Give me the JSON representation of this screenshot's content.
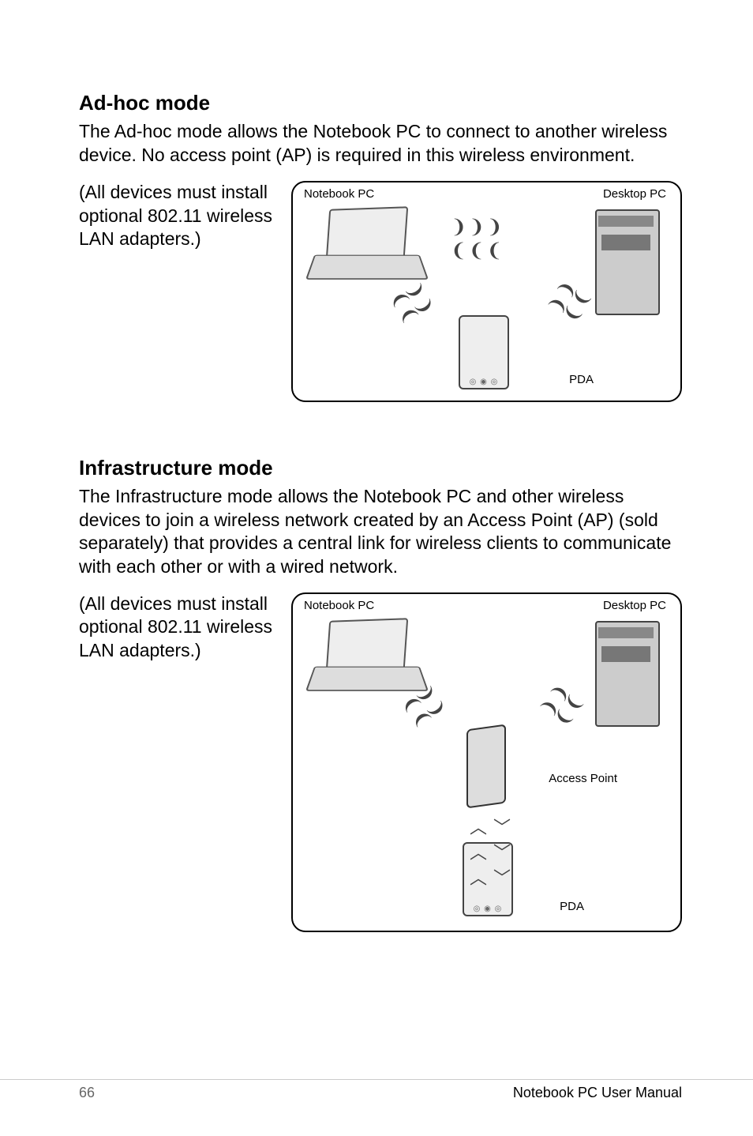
{
  "sections": {
    "adhoc": {
      "title": "Ad-hoc mode",
      "text": "The Ad-hoc mode allows the Notebook PC to connect to another wireless device. No access point (AP) is required in this wireless environment.",
      "note": "(All devices must install optional 802.11 wireless LAN adapters.)",
      "labels": {
        "notebook": "Notebook PC",
        "desktop": "Desktop PC",
        "pda": "PDA"
      }
    },
    "infra": {
      "title": "Infrastructure mode",
      "text": "The Infrastructure mode allows the Notebook PC and other wireless devices to join a wireless network created by an Access Point (AP) (sold separately) that provides a central link for wireless clients to communicate with each other or with a wired network.",
      "note": "(All devices must install optional 802.11 wireless LAN adapters.)",
      "labels": {
        "notebook": "Notebook PC",
        "desktop": "Desktop PC",
        "pda": "PDA",
        "ap": "Access Point"
      }
    }
  },
  "footer": {
    "page": "66",
    "manual": "Notebook PC User Manual"
  }
}
